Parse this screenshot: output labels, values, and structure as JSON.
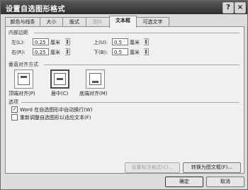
{
  "window": {
    "title": "设置自选图形格式",
    "help_glyph": "?",
    "close_glyph": "×"
  },
  "tabs": [
    {
      "label": "颜色与线条",
      "state": "normal"
    },
    {
      "label": "大小",
      "state": "normal"
    },
    {
      "label": "版式",
      "state": "normal"
    },
    {
      "label": "图片",
      "state": "disabled"
    },
    {
      "label": "文本框",
      "state": "active"
    },
    {
      "label": "可选文字",
      "state": "normal"
    }
  ],
  "margins": {
    "heading": "内部边距",
    "left": {
      "label": "左(L):",
      "value": "0.25",
      "unit": "厘米"
    },
    "right": {
      "label": "右(R):",
      "value": "0.25",
      "unit": "厘米"
    },
    "top": {
      "label": "上(U):",
      "value": "0.5",
      "unit": "厘米"
    },
    "bottom": {
      "label": "下(B):",
      "value": "0.5",
      "unit": "厘米"
    }
  },
  "valign": {
    "heading": "垂直对齐方式",
    "options": [
      {
        "label": "顶端对齐(P)",
        "icon": "align-top-icon",
        "selected": false
      },
      {
        "label": "居中(C)",
        "icon": "align-middle-icon",
        "selected": true
      },
      {
        "label": "底端对齐(M)",
        "icon": "align-bottom-icon",
        "selected": false
      }
    ]
  },
  "options": {
    "heading": "选项",
    "wrap": {
      "label": "Word 在自选图形中自动换行(W)",
      "checked": true,
      "check_glyph": "✓"
    },
    "resize": {
      "label": "重新调整自选图形以适应文本(F)",
      "checked": false,
      "check_glyph": ""
    }
  },
  "buttons": {
    "callout": "设置标注格式(C)...",
    "convert": "转换为图文框(F)...",
    "ok": "确定",
    "cancel": "取消"
  }
}
